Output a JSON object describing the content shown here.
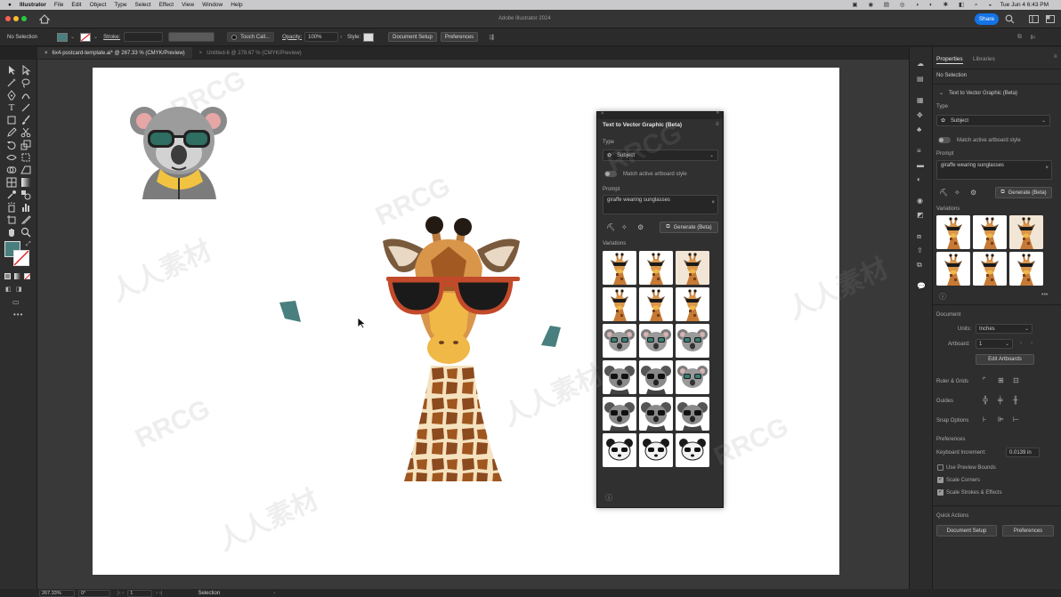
{
  "menubar": {
    "app": "Illustrator",
    "items": [
      "File",
      "Edit",
      "Object",
      "Type",
      "Select",
      "Effect",
      "View",
      "Window",
      "Help"
    ],
    "clock": "Tue Jun 4  6:43 PM"
  },
  "titlebar": {
    "title": "Adobe Illustrator 2024",
    "share": "Share"
  },
  "controlbar": {
    "selection": "No Selection",
    "stroke_label": "Stroke:",
    "brush": "Touch Call...",
    "opacity_label": "Opacity:",
    "opacity_value": "100%",
    "style_label": "Style:",
    "document_setup": "Document Setup",
    "preferences": "Preferences"
  },
  "tabs": [
    {
      "label": "6x4-postcard-template.ai* @ 267.33 % (CMYK/Preview)"
    },
    {
      "label": "Untitled-6 @ 278.67 % (CMYK/Preview)"
    }
  ],
  "panel": {
    "title": "Text to Vector Graphic (Beta)",
    "type_label": "Type",
    "type_value": "Subject",
    "match_label": "Match active artboard style",
    "prompt_label": "Prompt",
    "prompt_value": "giraffe wearing sunglasses",
    "generate": "Generate (Beta)",
    "variations_label": "Variations"
  },
  "props": {
    "tab_properties": "Properties",
    "tab_libraries": "Libraries",
    "no_selection": "No Selection",
    "section_title": "Text to Vector Graphic (Beta)",
    "type_label": "Type",
    "type_value": "Subject",
    "match_label": "Match active artboard style",
    "prompt_label": "Prompt",
    "prompt_value": "giraffe wearing sunglasses",
    "generate": "Generate (Beta)",
    "variations_label": "Variations",
    "document_label": "Document",
    "units_label": "Units:",
    "units_value": "Inches",
    "artboard_label": "Artboard:",
    "artboard_value": "1",
    "edit_artboards": "Edit Artboards",
    "ruler_grids": "Ruler & Grids",
    "guides": "Guides",
    "snap_options": "Snap Options",
    "preferences_label": "Preferences",
    "keyboard_increment_label": "Keyboard Increment:",
    "keyboard_increment_value": "0.0139 in",
    "use_preview_bounds": "Use Preview Bounds",
    "scale_corners": "Scale Corners",
    "scale_strokes": "Scale Strokes & Effects",
    "quick_actions": "Quick Actions",
    "qa_document_setup": "Document Setup",
    "qa_preferences": "Preferences"
  },
  "status": {
    "zoom": "267.33%",
    "angle": "0°",
    "artboard": "1",
    "tool": "Selection"
  },
  "colors": {
    "fill": "#4a7f7f",
    "accent": "#1473e6"
  }
}
